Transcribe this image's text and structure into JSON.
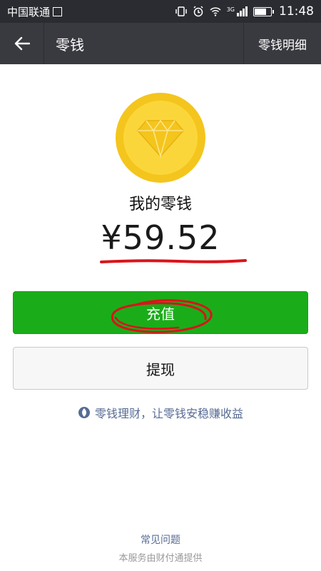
{
  "status_bar": {
    "carrier": "中国联通",
    "network": "3G",
    "time": "11:48",
    "battery_level": 0.75
  },
  "header": {
    "title": "零钱",
    "detail_link": "零钱明细"
  },
  "wallet": {
    "label": "我的零钱",
    "balance": "¥59.52"
  },
  "actions": {
    "recharge": "充值",
    "withdraw": "提现"
  },
  "promo": {
    "text": "零钱理财，让零钱安稳赚收益"
  },
  "footer": {
    "faq": "常见问题",
    "provider": "本服务由财付通提供"
  },
  "colors": {
    "accent_green": "#1aad19",
    "coin_gold": "#f4c51d",
    "link_blue": "#576b95",
    "annotation_red": "#d9141b"
  }
}
